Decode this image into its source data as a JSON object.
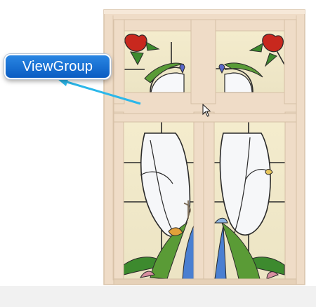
{
  "callout": {
    "label": "ViewGroup",
    "color": "#1474d6",
    "arrow_color": "#2bb7ea"
  },
  "image": {
    "subject": "stained-glass-window-icon",
    "frame_color": "#efdcc7"
  },
  "cursor": {
    "icon": "mouse-pointer-icon"
  }
}
